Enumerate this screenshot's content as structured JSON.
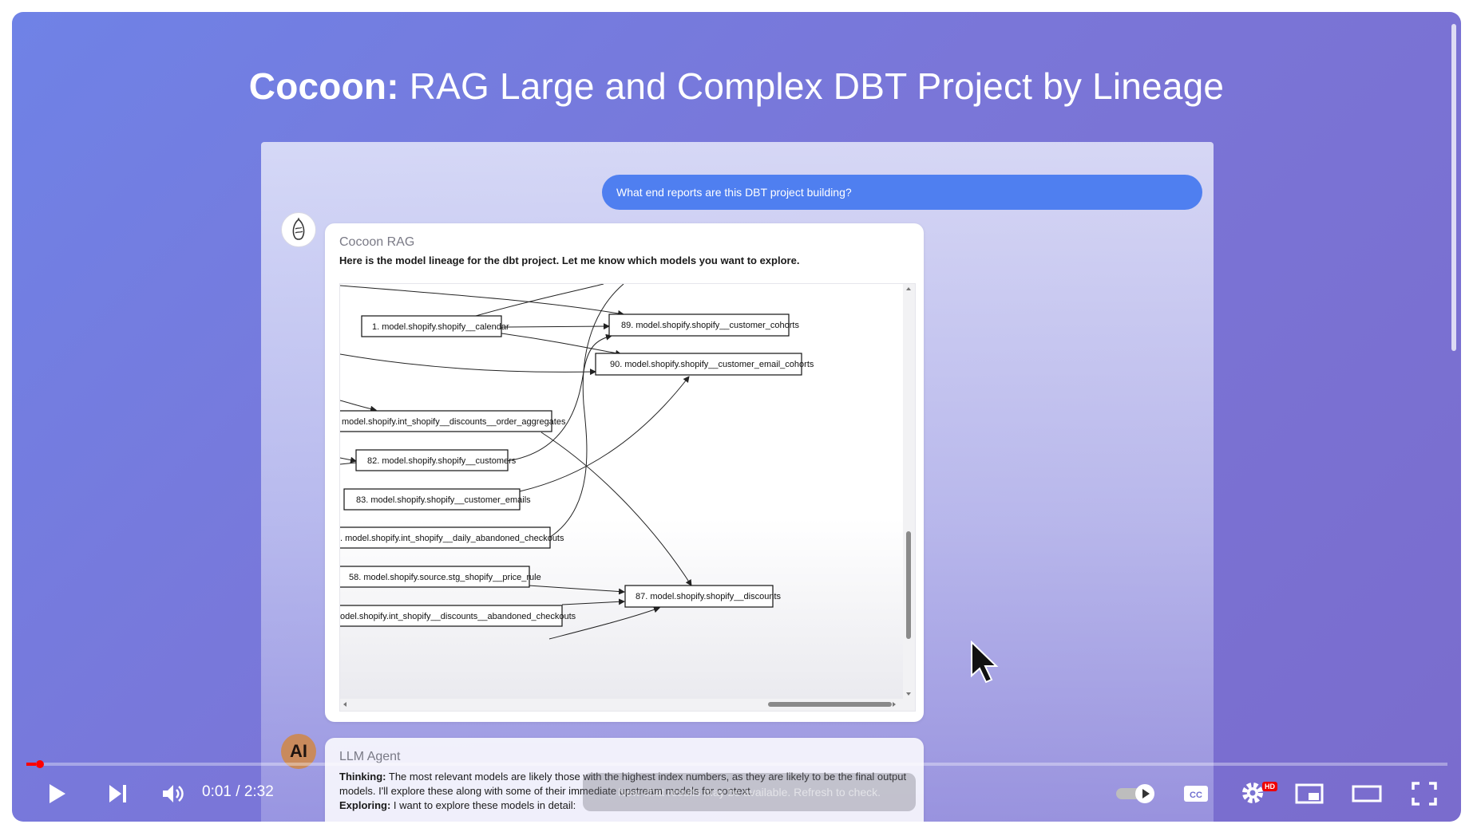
{
  "video": {
    "title_bold": "Cocoon:",
    "title_rest": " RAG Large and Complex DBT Project by Lineage"
  },
  "chat": {
    "user_message": "What end reports are this DBT project building?",
    "rag": {
      "sender": "Cocoon RAG",
      "text": "Here is the model lineage for the dbt project. Let me know which models you want to explore."
    },
    "agent": {
      "avatar_text": "AI",
      "sender": "LLM Agent",
      "thinking_label": "Thinking:",
      "thinking_text": "The most relevant models are likely those with the highest index numbers, as they are likely to be the final output models. I'll explore these along with some of their immediate upstream models for context.",
      "exploring_label": "Exploring:",
      "exploring_text": "I want to explore these models in detail:"
    },
    "toast": "New chat results may be available. Refresh to check."
  },
  "lineage_nodes": [
    {
      "label": "1. model.shopify.shopify__calendar"
    },
    {
      "label": "89. model.shopify.shopify__customer_cohorts"
    },
    {
      "label": "90. model.shopify.shopify__customer_email_cohorts"
    },
    {
      "label": "model.shopify.int_shopify__discounts__order_aggregates"
    },
    {
      "label": "82. model.shopify.shopify__customers"
    },
    {
      "label": "83. model.shopify.shopify__customer_emails"
    },
    {
      "label": ". model.shopify.int_shopify__daily_abandoned_checkouts"
    },
    {
      "label": "58. model.shopify.source.stg_shopify__price_rule"
    },
    {
      "label": "87. model.shopify.shopify__discounts"
    },
    {
      "label": "odel.shopify.int_shopify__discounts__abandoned_checkouts"
    }
  ],
  "player": {
    "time": "0:01 / 2:32",
    "progress": 0.007,
    "hd_badge": "HD",
    "icons": [
      "play-icon",
      "next-icon",
      "volume-icon",
      "autoplay-toggle-icon",
      "captions-icon",
      "settings-icon",
      "miniplayer-icon",
      "theater-icon",
      "fullscreen-icon"
    ],
    "accent_color": "#ff0000"
  }
}
